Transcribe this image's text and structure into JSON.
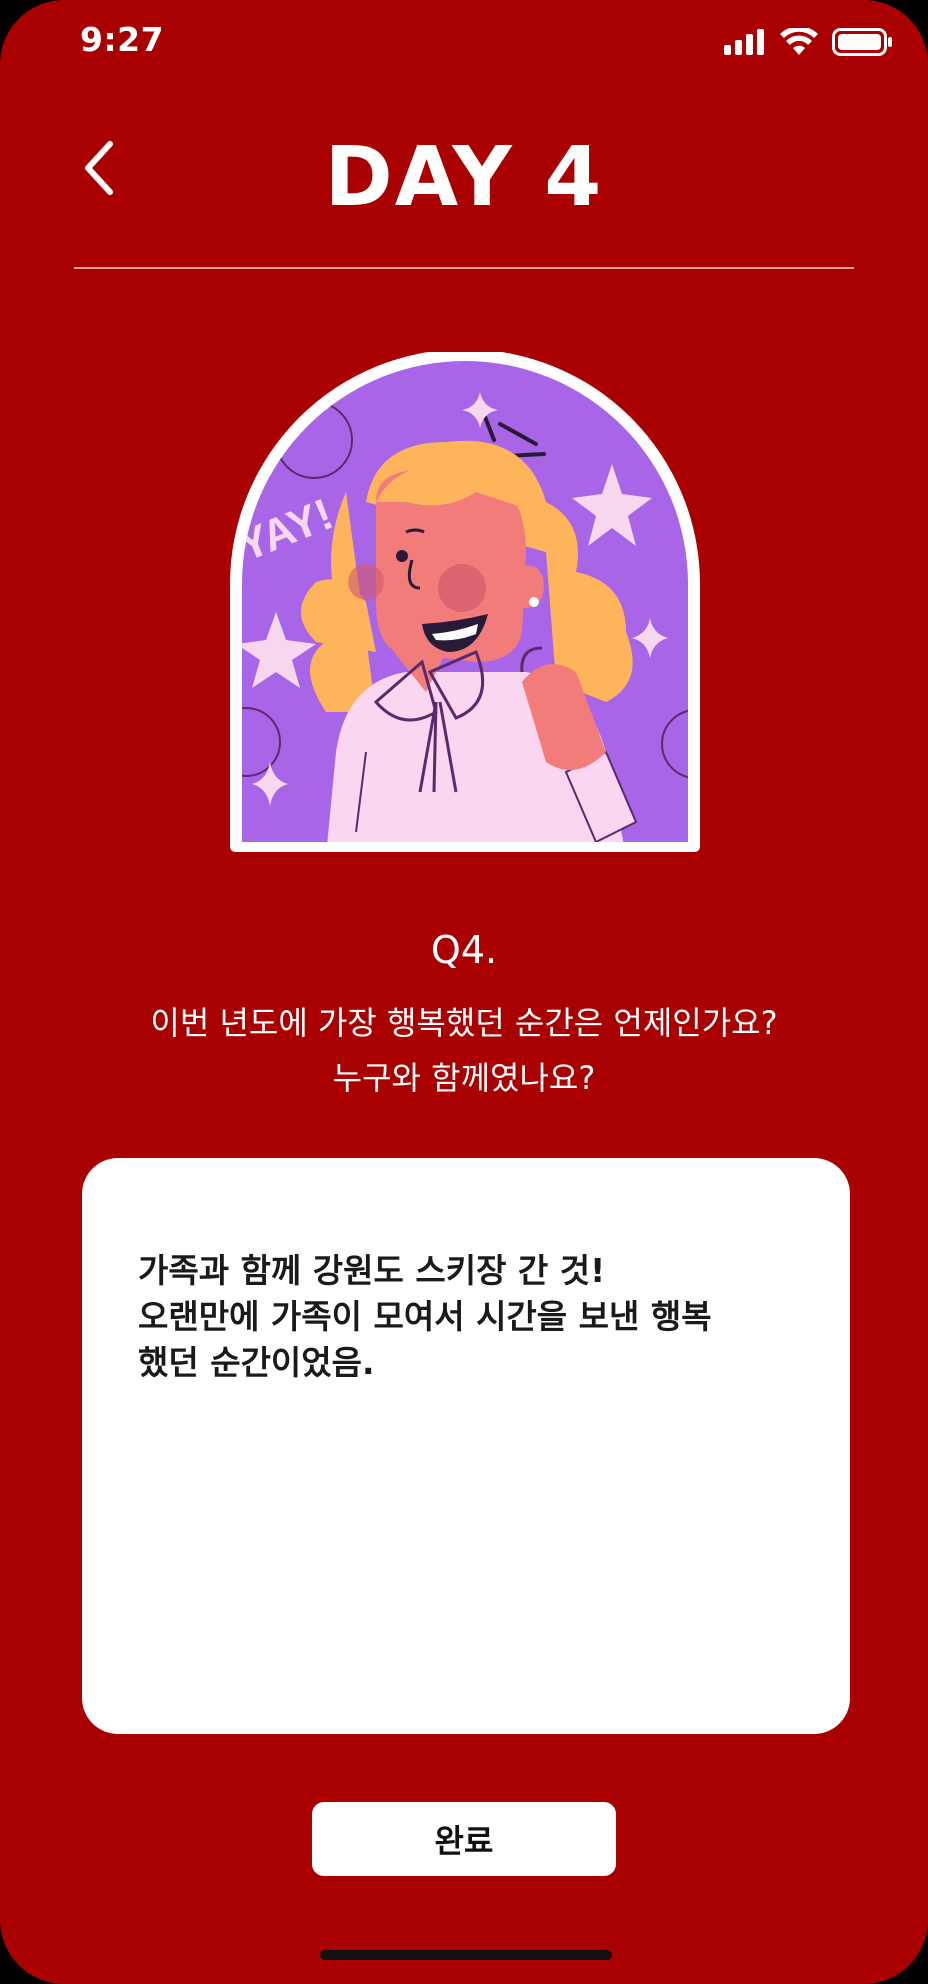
{
  "status_bar": {
    "time": "9:27",
    "icons": [
      "signal-icon",
      "wifi-icon",
      "battery-icon"
    ]
  },
  "header": {
    "back_icon": "chevron-left-icon",
    "title": "DAY 4"
  },
  "illustration": {
    "sticker_text": "YAY!"
  },
  "question": {
    "number": "Q4.",
    "text": "이번 년도에 가장 행복했던 순간은 언제인가요?\n누구와 함께였나요?"
  },
  "answer": {
    "text": "가족과 함께 강원도 스키장 간 것!\n오랜만에 가족이 모여서 시간을 보낸 행복\n했던 순간이었음."
  },
  "actions": {
    "complete_label": "완료"
  },
  "colors": {
    "background": "#A90002",
    "card": "#FFFFFF",
    "sticker_purple": "#A865E8",
    "hair": "#FDB45B"
  }
}
